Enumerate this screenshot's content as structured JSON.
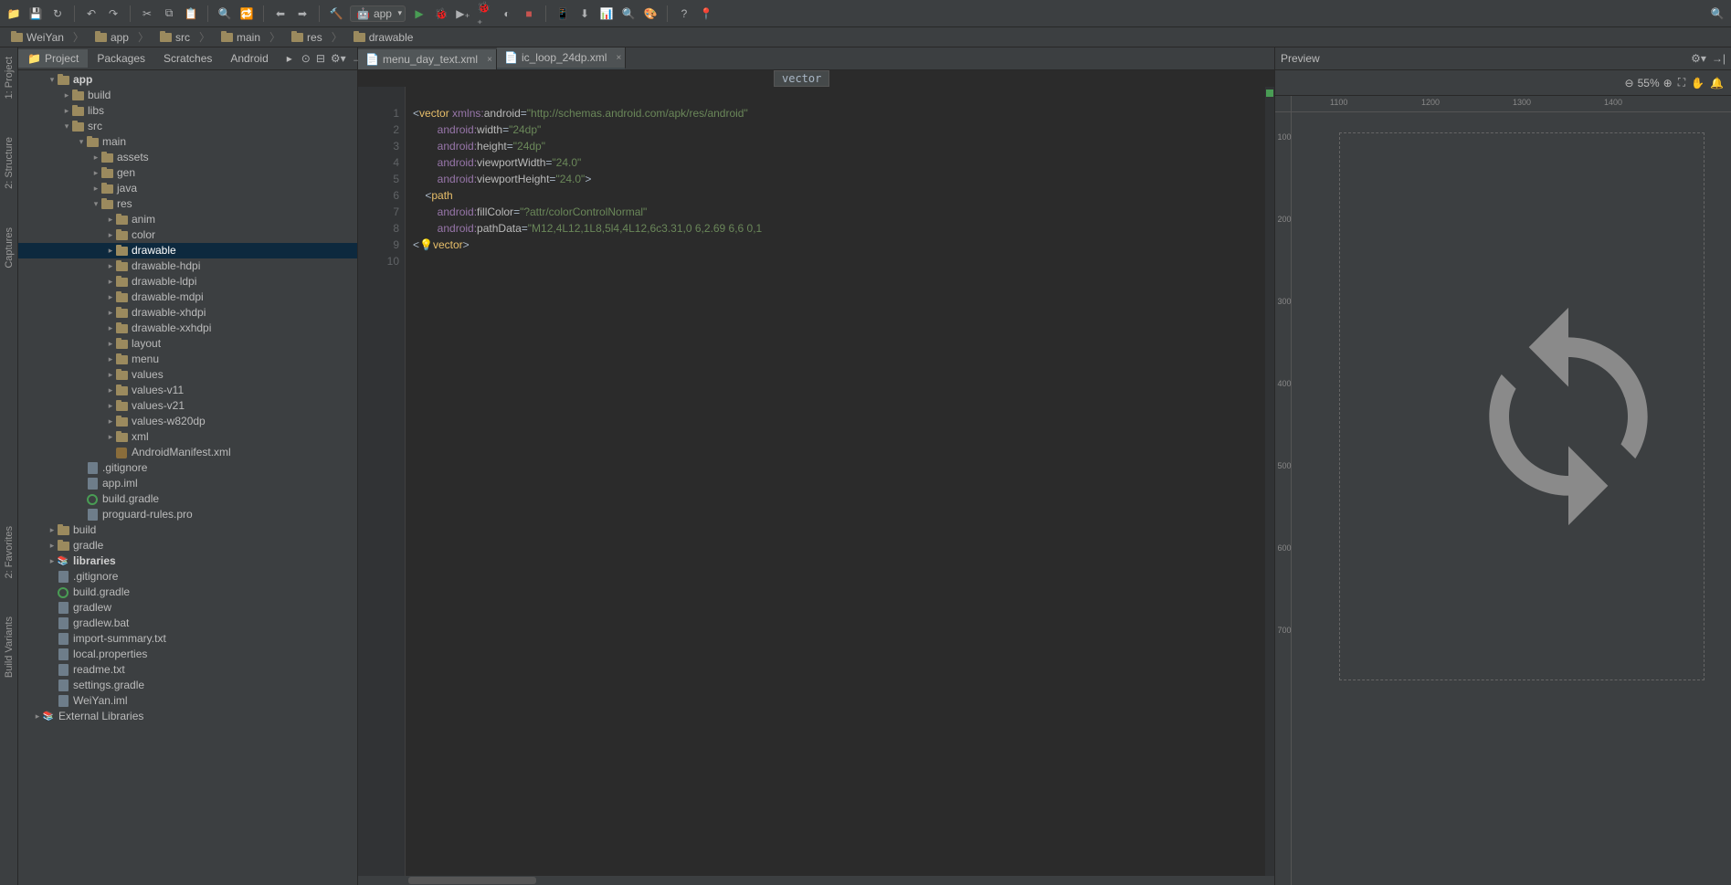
{
  "breadcrumbs": [
    "WeiYan",
    "app",
    "src",
    "main",
    "res",
    "drawable"
  ],
  "run_config": "app",
  "left_gutter": [
    "1: Project",
    "2: Structure",
    "Captures",
    "2: Favorites",
    "Build Variants"
  ],
  "project": {
    "tabs": [
      "Project",
      "Packages",
      "Scratches",
      "Android"
    ],
    "tree": [
      {
        "indent": 2,
        "arrow": "exp",
        "icon": "module",
        "label": "app",
        "bold": true
      },
      {
        "indent": 3,
        "arrow": "col",
        "icon": "folder",
        "label": "build"
      },
      {
        "indent": 3,
        "arrow": "col",
        "icon": "folder",
        "label": "libs"
      },
      {
        "indent": 3,
        "arrow": "exp",
        "icon": "folder",
        "label": "src"
      },
      {
        "indent": 4,
        "arrow": "exp",
        "icon": "folder",
        "label": "main"
      },
      {
        "indent": 5,
        "arrow": "col",
        "icon": "folder",
        "label": "assets"
      },
      {
        "indent": 5,
        "arrow": "col",
        "icon": "folder",
        "label": "gen"
      },
      {
        "indent": 5,
        "arrow": "col",
        "icon": "folder",
        "label": "java"
      },
      {
        "indent": 5,
        "arrow": "exp",
        "icon": "folder",
        "label": "res"
      },
      {
        "indent": 6,
        "arrow": "col",
        "icon": "folder",
        "label": "anim"
      },
      {
        "indent": 6,
        "arrow": "col",
        "icon": "folder",
        "label": "color"
      },
      {
        "indent": 6,
        "arrow": "col",
        "icon": "folder",
        "label": "drawable",
        "selected": true
      },
      {
        "indent": 6,
        "arrow": "col",
        "icon": "folder",
        "label": "drawable-hdpi"
      },
      {
        "indent": 6,
        "arrow": "col",
        "icon": "folder",
        "label": "drawable-ldpi"
      },
      {
        "indent": 6,
        "arrow": "col",
        "icon": "folder",
        "label": "drawable-mdpi"
      },
      {
        "indent": 6,
        "arrow": "col",
        "icon": "folder",
        "label": "drawable-xhdpi"
      },
      {
        "indent": 6,
        "arrow": "col",
        "icon": "folder",
        "label": "drawable-xxhdpi"
      },
      {
        "indent": 6,
        "arrow": "col",
        "icon": "folder",
        "label": "layout"
      },
      {
        "indent": 6,
        "arrow": "col",
        "icon": "folder",
        "label": "menu"
      },
      {
        "indent": 6,
        "arrow": "col",
        "icon": "folder",
        "label": "values"
      },
      {
        "indent": 6,
        "arrow": "col",
        "icon": "folder",
        "label": "values-v11"
      },
      {
        "indent": 6,
        "arrow": "col",
        "icon": "folder",
        "label": "values-v21"
      },
      {
        "indent": 6,
        "arrow": "col",
        "icon": "folder",
        "label": "values-w820dp"
      },
      {
        "indent": 6,
        "arrow": "col",
        "icon": "folder",
        "label": "xml"
      },
      {
        "indent": 6,
        "arrow": "",
        "icon": "xml",
        "label": "AndroidManifest.xml"
      },
      {
        "indent": 4,
        "arrow": "",
        "icon": "file",
        "label": ".gitignore"
      },
      {
        "indent": 4,
        "arrow": "",
        "icon": "file",
        "label": "app.iml"
      },
      {
        "indent": 4,
        "arrow": "",
        "icon": "gradle",
        "label": "build.gradle"
      },
      {
        "indent": 4,
        "arrow": "",
        "icon": "file",
        "label": "proguard-rules.pro"
      },
      {
        "indent": 2,
        "arrow": "col",
        "icon": "folder",
        "label": "build"
      },
      {
        "indent": 2,
        "arrow": "col",
        "icon": "folder",
        "label": "gradle"
      },
      {
        "indent": 2,
        "arrow": "col",
        "icon": "lib",
        "label": "libraries",
        "bold": true
      },
      {
        "indent": 2,
        "arrow": "",
        "icon": "file",
        "label": ".gitignore"
      },
      {
        "indent": 2,
        "arrow": "",
        "icon": "gradle",
        "label": "build.gradle"
      },
      {
        "indent": 2,
        "arrow": "",
        "icon": "file",
        "label": "gradlew"
      },
      {
        "indent": 2,
        "arrow": "",
        "icon": "file",
        "label": "gradlew.bat"
      },
      {
        "indent": 2,
        "arrow": "",
        "icon": "file",
        "label": "import-summary.txt"
      },
      {
        "indent": 2,
        "arrow": "",
        "icon": "file",
        "label": "local.properties"
      },
      {
        "indent": 2,
        "arrow": "",
        "icon": "file",
        "label": "readme.txt"
      },
      {
        "indent": 2,
        "arrow": "",
        "icon": "file",
        "label": "settings.gradle"
      },
      {
        "indent": 2,
        "arrow": "",
        "icon": "file",
        "label": "WeiYan.iml"
      },
      {
        "indent": 1,
        "arrow": "col",
        "icon": "lib",
        "label": "External Libraries"
      }
    ]
  },
  "editor": {
    "tabs": [
      {
        "name": "menu_day_text.xml",
        "active": false
      },
      {
        "name": "ic_loop_24dp.xml",
        "active": true
      }
    ],
    "hint": "vector",
    "lines": [
      "1",
      "2",
      "3",
      "4",
      "5",
      "6",
      "7",
      "8",
      "9",
      "10"
    ],
    "code": {
      "l1_ns_url": "\"http://schemas.android.com/apk/res/android\"",
      "l2_val": "\"24dp\"",
      "l3_val": "\"24dp\"",
      "l4_val": "\"24.0\"",
      "l5_val": "\"24.0\"",
      "l7_val": "\"?attr/colorControlNormal\"",
      "l8_val": "\"M12,4L12,1L8,5l4,4L12,6c3.31,0 6,2.69 6,6 0,1"
    }
  },
  "preview": {
    "title": "Preview",
    "zoom": "55%",
    "ruler_h": [
      "1100",
      "1200",
      "1300",
      "1400"
    ],
    "ruler_v": [
      "100",
      "200",
      "300",
      "400",
      "500",
      "600",
      "700"
    ]
  }
}
